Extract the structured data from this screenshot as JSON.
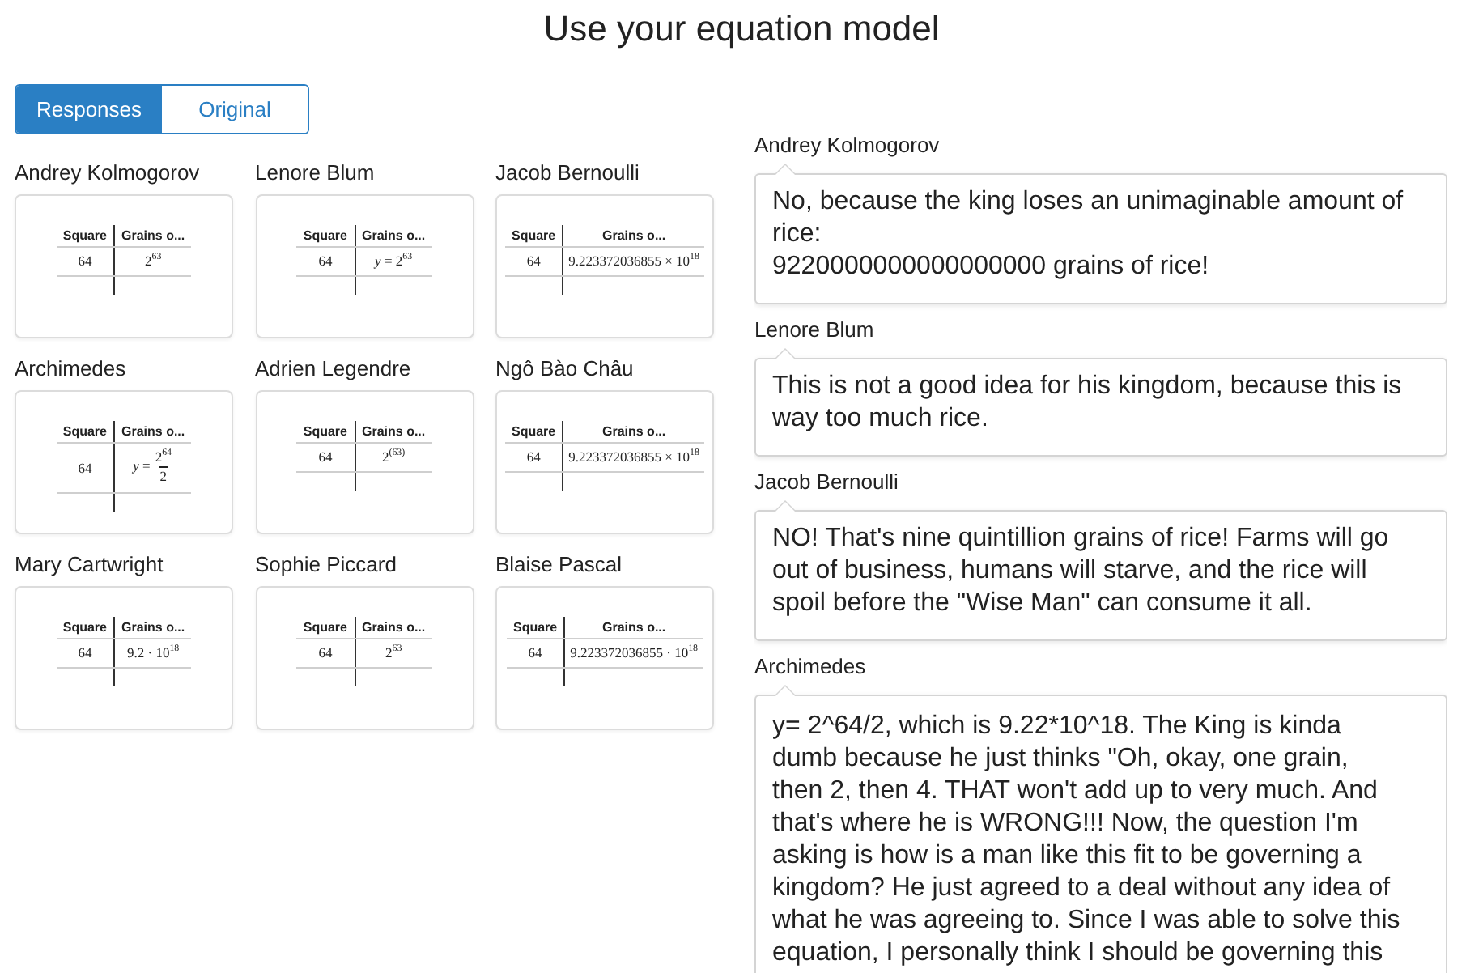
{
  "title": "Use your equation model",
  "view_tabs": [
    {
      "label": "Responses",
      "selected": true
    },
    {
      "label": "Original",
      "selected": false
    }
  ],
  "cards": [
    {
      "student": "Andrey Kolmogorov",
      "table": {
        "columns": [
          "Square",
          "Grains o..."
        ],
        "rows": [
          [
            {
              "kind": "text",
              "text": "64"
            },
            {
              "kind": "text",
              "text": "2$^{63}$"
            }
          ]
        ]
      }
    },
    {
      "student": "Lenore Blum",
      "table": {
        "columns": [
          "Square",
          "Grains o..."
        ],
        "rows": [
          [
            {
              "kind": "text",
              "text": "64"
            },
            {
              "kind": "text",
              "text": "*y* = 2$^{63}$"
            }
          ]
        ]
      }
    },
    {
      "student": "Jacob Bernoulli",
      "table": {
        "columns": [
          "Square",
          "Grains o..."
        ],
        "rows": [
          [
            {
              "kind": "text",
              "text": "64"
            },
            {
              "kind": "text",
              "text": "9.223372036855 × 10$^{18}$"
            }
          ]
        ]
      }
    },
    {
      "student": "Archimedes",
      "table": {
        "columns": [
          "Square",
          "Grains o..."
        ],
        "rows": [
          [
            {
              "kind": "text",
              "text": "64"
            },
            {
              "kind": "fraction",
              "lead": "*y* =",
              "numerator": "2$^{64}$",
              "denominator": "2"
            }
          ]
        ]
      }
    },
    {
      "student": "Adrien Legendre",
      "table": {
        "columns": [
          "Square",
          "Grains o..."
        ],
        "rows": [
          [
            {
              "kind": "text",
              "text": "64"
            },
            {
              "kind": "text",
              "text": "2$^{(63)}$"
            }
          ]
        ]
      }
    },
    {
      "student": "Ngô Bào Châu",
      "table": {
        "columns": [
          "Square",
          "Grains o..."
        ],
        "rows": [
          [
            {
              "kind": "text",
              "text": "64"
            },
            {
              "kind": "text",
              "text": "9.223372036855 × 10$^{18}$"
            }
          ]
        ]
      }
    },
    {
      "student": "Mary Cartwright",
      "table": {
        "columns": [
          "Square",
          "Grains o..."
        ],
        "rows": [
          [
            {
              "kind": "text",
              "text": "64"
            },
            {
              "kind": "text",
              "text": "9.2 · 10$^{18}$"
            }
          ]
        ]
      }
    },
    {
      "student": "Sophie Piccard",
      "table": {
        "columns": [
          "Square",
          "Grains o..."
        ],
        "rows": [
          [
            {
              "kind": "text",
              "text": "64"
            },
            {
              "kind": "text",
              "text": "2$^{63}$"
            }
          ]
        ]
      }
    },
    {
      "student": "Blaise Pascal",
      "table": {
        "columns": [
          "Square",
          "Grains o..."
        ],
        "rows": [
          [
            {
              "kind": "text",
              "text": "64"
            },
            {
              "kind": "text",
              "text": "9.223372036855 · 10$^{18}$"
            }
          ]
        ]
      }
    }
  ],
  "responses": [
    {
      "student": "Andrey Kolmogorov",
      "text": "No, because the king loses an unimaginable amount of rice:\n9220000000000000000 grains of rice!"
    },
    {
      "student": "Lenore Blum",
      "text": "This is not a good idea for his kingdom, because this is way too much rice."
    },
    {
      "student": "Jacob Bernoulli",
      "text": "NO! That's nine quintillion grains of rice! Farms will go out of business, humans will starve, and the rice will spoil before the \"Wise Man\" can consume it all."
    },
    {
      "student": "Archimedes",
      "text": "y= 2^64/2, which is 9.22*10^18. The King is kinda dumb because he just thinks \"Oh, okay, one grain, then 2, then 4. THAT won't add up to very much. And that's where he is WRONG!!! Now, the question I'm asking is how is a man like this fit to be governing a kingdom? He just agreed to a deal without any idea of what he was agreeing to. Since I was able to solve this equation, I personally think I should be governing this"
    }
  ]
}
